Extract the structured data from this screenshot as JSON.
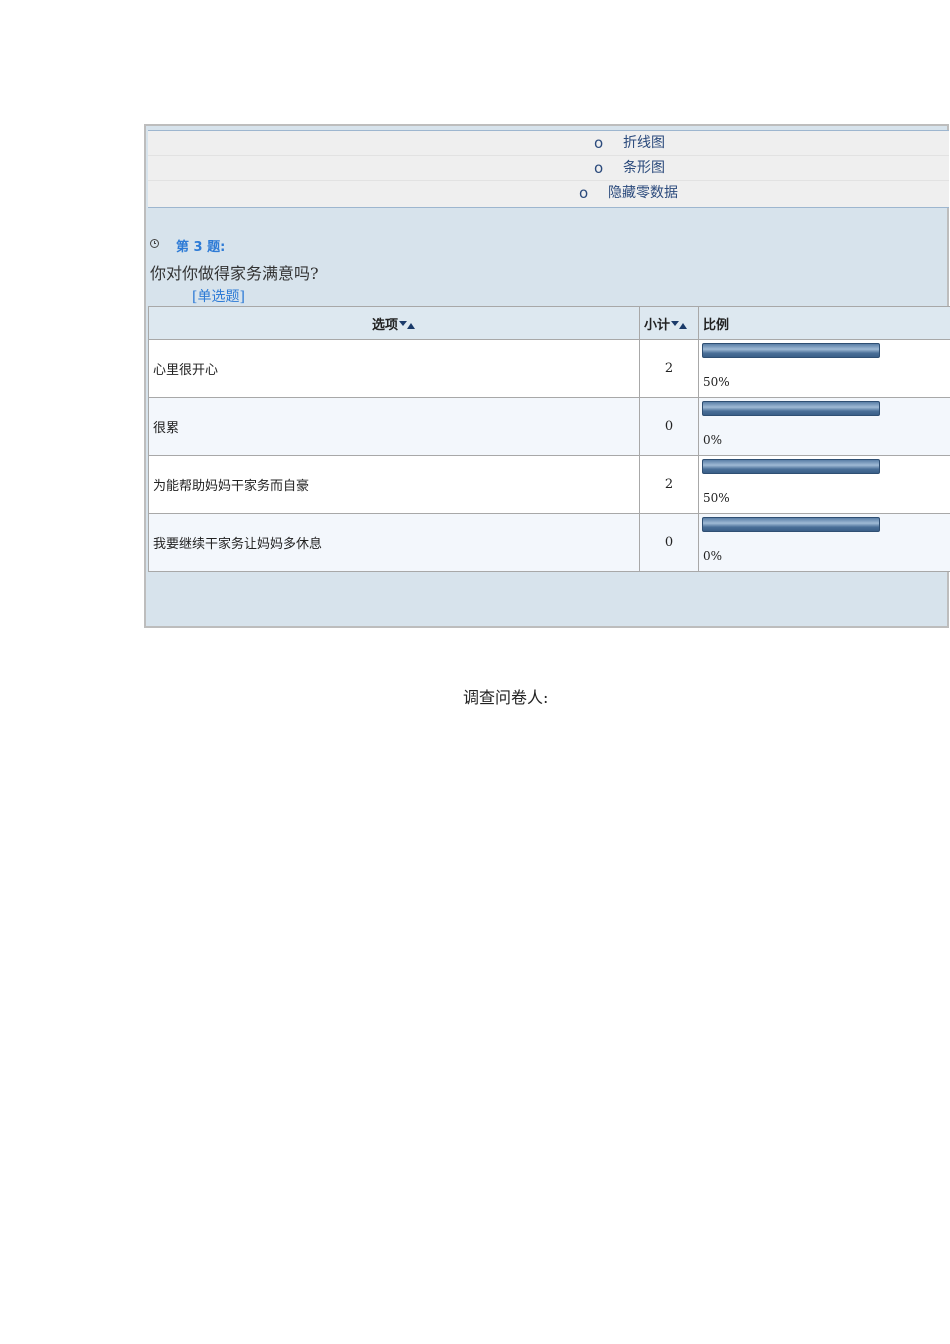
{
  "chart_links": [
    {
      "bullet": "o",
      "label": "折线图"
    },
    {
      "bullet": "o",
      "label": "条形图"
    },
    {
      "bullet": "o",
      "label": "隐藏零数据"
    }
  ],
  "question": {
    "number_label": "第 3 题:",
    "text": "你对你做得家务满意吗?",
    "type_label": "[单选题]"
  },
  "table": {
    "headers": {
      "option": "选项",
      "count": "小计",
      "ratio": "比例"
    },
    "rows": [
      {
        "option": "心里很开心",
        "count": "2",
        "percent": "50%",
        "bar_fill": 1.0
      },
      {
        "option": "很累",
        "count": "0",
        "percent": "0%",
        "bar_fill": 1.0
      },
      {
        "option": "为能帮助妈妈干家务而自豪",
        "count": "2",
        "percent": "50%",
        "bar_fill": 1.0
      },
      {
        "option": "我要继续干家务让妈妈多休息",
        "count": "0",
        "percent": "0%",
        "bar_fill": 1.0
      }
    ]
  },
  "footer_label": "调查问卷人:",
  "colors": {
    "link": "#2b4a7c",
    "accent_blue": "#2e7bd6",
    "panel_bg": "#d7e3ec",
    "bar": "#4a6f98"
  },
  "icons": {
    "question_marker": "clock-icon",
    "sort": "sort-arrows-icon"
  }
}
